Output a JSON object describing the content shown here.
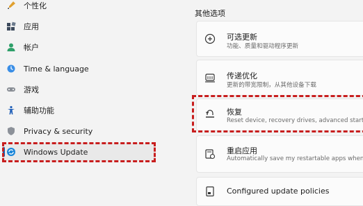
{
  "sidebar": {
    "items": [
      {
        "label": "个性化",
        "icon": "paint-brush-icon"
      },
      {
        "label": "应用",
        "icon": "apps-icon"
      },
      {
        "label": "帐户",
        "icon": "person-icon"
      },
      {
        "label": "Time & language",
        "icon": "globe-clock-icon"
      },
      {
        "label": "游戏",
        "icon": "gamepad-icon"
      },
      {
        "label": "辅助功能",
        "icon": "accessibility-icon"
      },
      {
        "label": "Privacy & security",
        "icon": "shield-icon"
      },
      {
        "label": "Windows Update",
        "icon": "windows-update-icon"
      }
    ],
    "selected_index": 7
  },
  "main": {
    "section_title": "其他选项",
    "cards": [
      {
        "title": "可选更新",
        "subtitle": "功能、质量和驱动程序更新",
        "icon": "add-circle-icon"
      },
      {
        "title": "传递优化",
        "subtitle": "更新的带宽限制，从其他设备下载",
        "icon": "delivery-icon"
      },
      {
        "title": "恢复",
        "subtitle": "Reset device, recovery drives, advanced startup, r",
        "icon": "recovery-icon"
      },
      {
        "title": "重启应用",
        "subtitle": "Automatically save my restartable apps when I si",
        "icon": "restart-apps-icon"
      },
      {
        "title": "Configured update policies",
        "subtitle": "",
        "icon": "policy-icon"
      }
    ]
  },
  "colors": {
    "accent": "#0067c0",
    "highlight_dash": "#c81e1e",
    "background": "#f3f3f3",
    "card": "#fbfbfb"
  }
}
